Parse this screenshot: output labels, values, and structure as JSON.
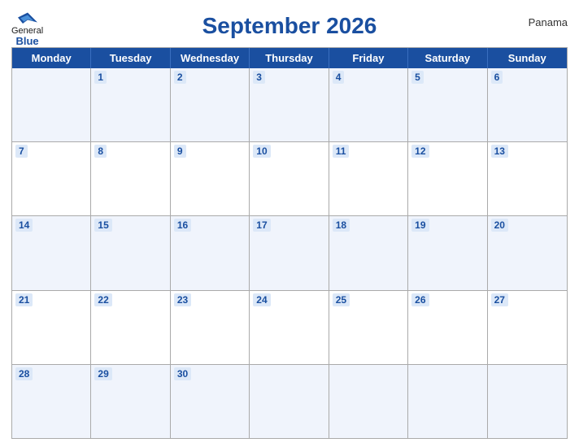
{
  "header": {
    "title": "September 2026",
    "country": "Panama",
    "logo": {
      "general": "General",
      "blue": "Blue"
    }
  },
  "days_of_week": [
    "Monday",
    "Tuesday",
    "Wednesday",
    "Thursday",
    "Friday",
    "Saturday",
    "Sunday"
  ],
  "weeks": [
    [
      {
        "date": "",
        "empty": true
      },
      {
        "date": "1"
      },
      {
        "date": "2"
      },
      {
        "date": "3"
      },
      {
        "date": "4"
      },
      {
        "date": "5"
      },
      {
        "date": "6"
      }
    ],
    [
      {
        "date": "7"
      },
      {
        "date": "8"
      },
      {
        "date": "9"
      },
      {
        "date": "10"
      },
      {
        "date": "11"
      },
      {
        "date": "12"
      },
      {
        "date": "13"
      }
    ],
    [
      {
        "date": "14"
      },
      {
        "date": "15"
      },
      {
        "date": "16"
      },
      {
        "date": "17"
      },
      {
        "date": "18"
      },
      {
        "date": "19"
      },
      {
        "date": "20"
      }
    ],
    [
      {
        "date": "21"
      },
      {
        "date": "22"
      },
      {
        "date": "23"
      },
      {
        "date": "24"
      },
      {
        "date": "25"
      },
      {
        "date": "26"
      },
      {
        "date": "27"
      }
    ],
    [
      {
        "date": "28"
      },
      {
        "date": "29"
      },
      {
        "date": "30"
      },
      {
        "date": "",
        "empty": true
      },
      {
        "date": "",
        "empty": true
      },
      {
        "date": "",
        "empty": true
      },
      {
        "date": "",
        "empty": true
      }
    ]
  ]
}
